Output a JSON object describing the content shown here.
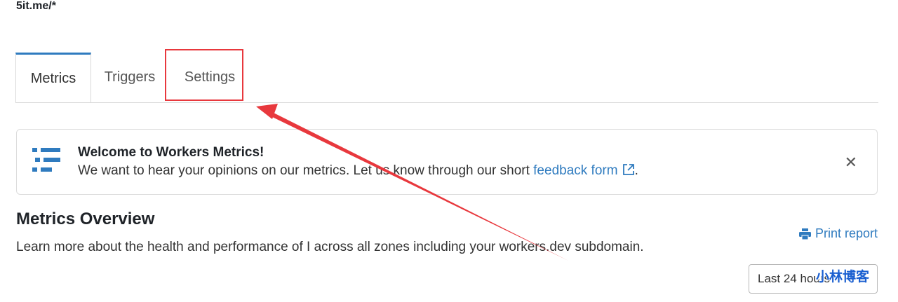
{
  "route": "5it.me/*",
  "tabs": [
    {
      "label": "Metrics",
      "active": true
    },
    {
      "label": "Triggers",
      "active": false
    },
    {
      "label": "Settings",
      "active": false
    }
  ],
  "banner": {
    "title": "Welcome to Workers Metrics!",
    "text": "We want to hear your opinions on our metrics. Let us know through our short ",
    "link": "feedback form",
    "period": ".",
    "icon": "list-icon",
    "close": "✕"
  },
  "overview": {
    "title": "Metrics Overview",
    "description": "Learn more about the health and performance of I across all zones including your workers.dev subdomain.",
    "print_report": "Print report",
    "time_range": "Last 24 hours"
  },
  "watermark": "小林博客",
  "colors": {
    "accent": "#2f7bbf",
    "annotation_red": "#e8383d"
  }
}
